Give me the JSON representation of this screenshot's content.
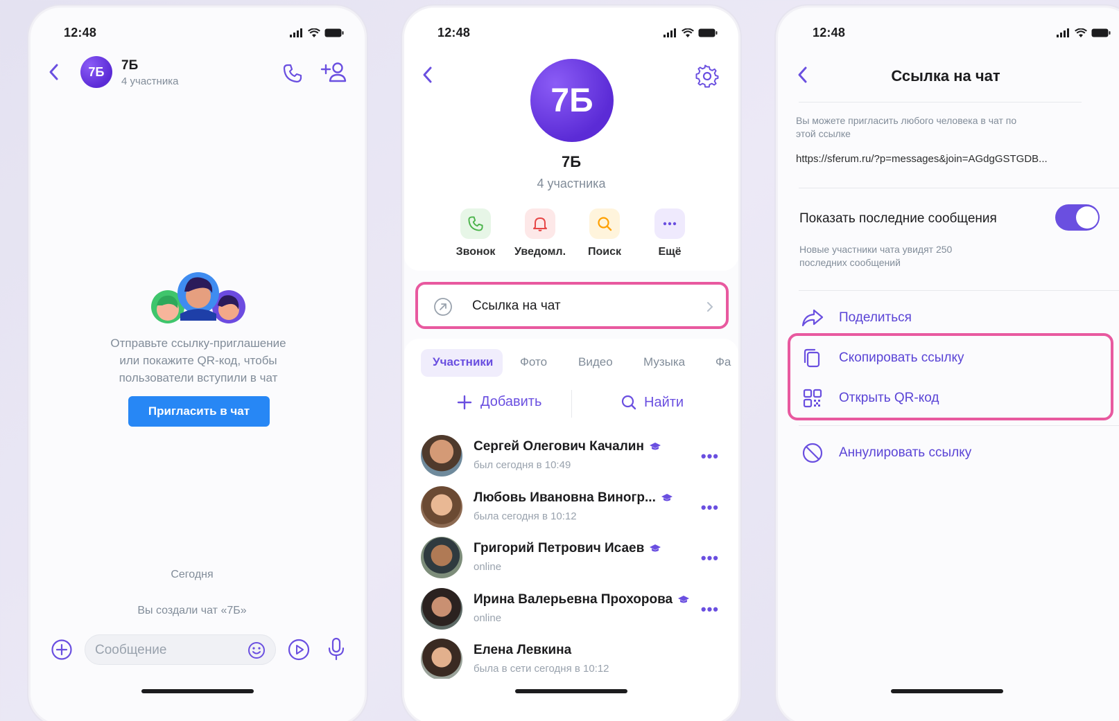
{
  "status": {
    "time": "12:48"
  },
  "colors": {
    "accent": "#6a4fe0",
    "blue": "#2787f5",
    "highlight": "#e8599f",
    "toggle": "#6a4fe0"
  },
  "screen1": {
    "chat_title": "7Б",
    "chat_subtitle": "4 участника",
    "avatar_text": "7Б",
    "empty_text_line1": "Отправьте ссылку-приглашение",
    "empty_text_line2": "или покажите QR-код, чтобы",
    "empty_text_line3": "пользователи вступили в чат",
    "invite_button": "Пригласить в чат",
    "date_separator": "Сегодня",
    "system_message": "Вы создали чат «7Б»",
    "input_placeholder": "Сообщение",
    "icons": [
      "back-icon",
      "phone-icon",
      "add-user-icon",
      "plus-circle-icon",
      "emoji-icon",
      "video-message-icon",
      "microphone-icon"
    ]
  },
  "screen2": {
    "avatar_text": "7Б",
    "title": "7Б",
    "subtitle": "4 участника",
    "actions": [
      {
        "label": "Звонок",
        "icon": "phone-icon",
        "color": "#4bb34b"
      },
      {
        "label": "Уведомл.",
        "icon": "bell-icon",
        "color": "#e64646"
      },
      {
        "label": "Поиск",
        "icon": "search-icon",
        "color": "#ffa000"
      },
      {
        "label": "Ещё",
        "icon": "more-icon",
        "color": "#6a4fe0"
      }
    ],
    "link_row": "Ссылка на чат",
    "tabs": [
      "Участники",
      "Фото",
      "Видео",
      "Музыка",
      "Фа"
    ],
    "add_label": "Добавить",
    "find_label": "Найти",
    "members": [
      {
        "name": "Сергей Олегович Качалин",
        "status": "был сегодня в 10:49"
      },
      {
        "name": "Любовь Ивановна Виногр...",
        "status": "была сегодня в 10:12"
      },
      {
        "name": "Григорий Петрович Исаев",
        "status": "online"
      },
      {
        "name": "Ирина Валерьевна Прохорова",
        "status": "online"
      },
      {
        "name": "Елена Левкина",
        "status": "была в сети сегодня в 10:12"
      }
    ]
  },
  "screen3": {
    "title": "Ссылка на чат",
    "description_line1": "Вы можете пригласить любого человека в чат по",
    "description_line2": "этой ссылке",
    "link": "https://sferum.ru/?p=messages&join=AGdgGSTGDB...",
    "toggle_label": "Показать последние сообщения",
    "toggle_on": true,
    "toggle_hint_line1": "Новые участники чата увидят 250",
    "toggle_hint_line2": "последних сообщений",
    "share": "Поделиться",
    "copy": "Скопировать ссылку",
    "qr": "Открыть QR-код",
    "revoke": "Аннулировать ссылку"
  }
}
